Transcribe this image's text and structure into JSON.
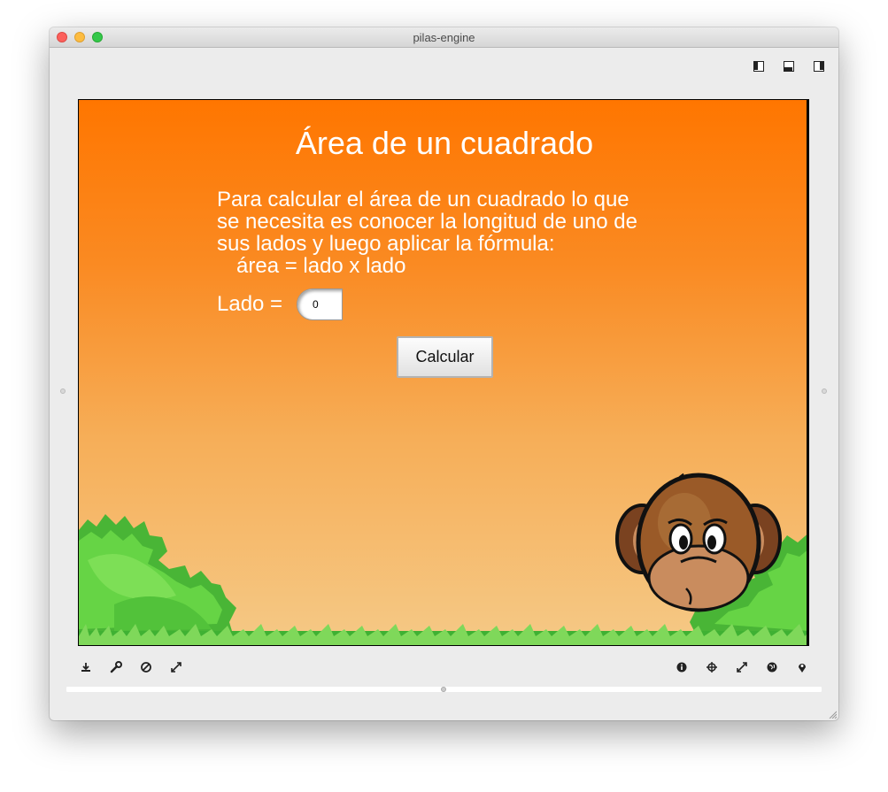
{
  "window": {
    "title": "pilas-engine"
  },
  "scene": {
    "title": "Área de un cuadrado",
    "paragraph": [
      "Para calcular el área de un cuadrado lo que",
      "se necesita es conocer la longitud de uno de",
      "sus lados y luego aplicar la fórmula:",
      "área = lado x lado"
    ],
    "lado_label": "Lado =",
    "lado_value": "0",
    "calc_button": "Calcular"
  },
  "toolbar_left_icons": [
    "save-icon",
    "wrench-icon",
    "block-icon",
    "expand-icon"
  ],
  "toolbar_right_icons": [
    "info-icon",
    "crosshair-icon",
    "fullscreen-icon",
    "globe-icon",
    "map-pin-icon"
  ],
  "colors": {
    "sky_top": "#ff7600",
    "sky_bottom": "#f5c986",
    "bush": "#5fc93e",
    "grass": "#4cbf3c",
    "monkey": "#9a5a28"
  }
}
